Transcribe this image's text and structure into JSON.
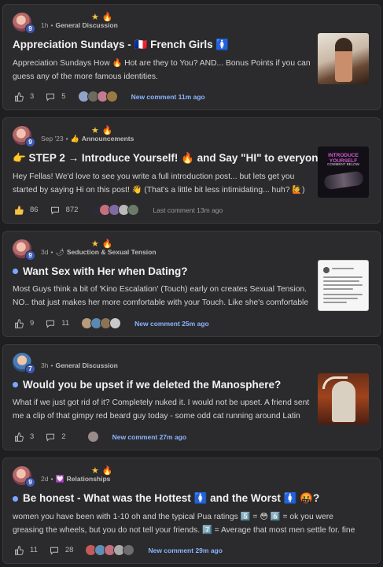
{
  "posts": [
    {
      "level": "9",
      "time": "1h",
      "category_icon": "",
      "category": "General Discussion",
      "unread": false,
      "title_prefix_emoji": "",
      "title": "Appreciation Sundays - 🇫🇷 French Girls 🚺",
      "excerpt": "Appreciation Sundays How 🔥 Hot are they to You? AND... Bonus Points if you can guess any of the more famous identities.",
      "likes": "3",
      "comments": "5",
      "participants": 4,
      "activity": "New comment 11m ago",
      "activity_muted": false,
      "thumb": "t1"
    },
    {
      "level": "9",
      "time": "Sep '23",
      "category_icon": "👍",
      "category": "Announcements",
      "unread": false,
      "title": "👉 STEP 2 → Introduce Yourself! 🔥 and Say \"HI\" to everyone",
      "excerpt": "Hey Fellas! We'd love to see you write a full introduction post... but lets get you started by saying Hi on this post! 👋 (That's a little bit less intimidating... huh? 🙋)",
      "likes": "86",
      "comments": "872",
      "participants": 5,
      "activity": "Last comment 13m ago",
      "activity_muted": true,
      "thumb": "t2",
      "thumb_text1": "INTRODUCE",
      "thumb_text1b": "YOURSELF",
      "thumb_text2": "COMMENT BELOW"
    },
    {
      "level": "9",
      "time": "3d",
      "category_icon": "🌶",
      "category": "Seduction & Sexual Tension",
      "unread": true,
      "title": "Want Sex with Her when Dating?",
      "excerpt": "Most Guys think a bit of 'Kino Escalation' (Touch) early on creates Sexual Tension. NO.. that just makes her more comfortable with your Touch. Like she's comfortable with the",
      "likes": "9",
      "comments": "11",
      "participants": 4,
      "activity": "New comment 25m ago",
      "activity_muted": false,
      "thumb": "t3"
    },
    {
      "level": "7",
      "time": "3h",
      "category_icon": "",
      "category": "General Discussion",
      "unread": true,
      "title": "Would you be upset if we deleted the Manosphere?",
      "excerpt": "What if we just got rid of it? Completely nuked it. I would not be upset. A friend sent me a clip of that gimpy red beard guy today - some odd cat running around Latin America",
      "likes": "3",
      "comments": "2",
      "participants": 2,
      "activity": "New comment 27m ago",
      "activity_muted": false,
      "thumb": "t4"
    },
    {
      "level": "9",
      "time": "2d",
      "category_icon": "💟",
      "category": "Relationships",
      "unread": true,
      "title": "Be honest - What was the Hottest 🚺 and the Worst 🚺 🤬?",
      "excerpt": "women you have been with 1-10 oh and the typical Pua ratings 5️⃣ = 😳 6️⃣ = ok you were greasing the wheels, but you do not tell your friends. 7️⃣ = Average that most men settle for. fine if she is kind and",
      "likes": "11",
      "comments": "28",
      "participants": 5,
      "activity": "New comment 29m ago",
      "activity_muted": false,
      "thumb": ""
    }
  ],
  "icons": {
    "like": "thumbs-up-icon",
    "comment": "comment-bubble-icon",
    "star": "star-icon",
    "fire": "fire-icon"
  },
  "colors": {
    "accent": "#8ab4ff",
    "level_badge": "#3c5ab3",
    "card": "#2b2b2d",
    "background": "#1f1f21"
  }
}
